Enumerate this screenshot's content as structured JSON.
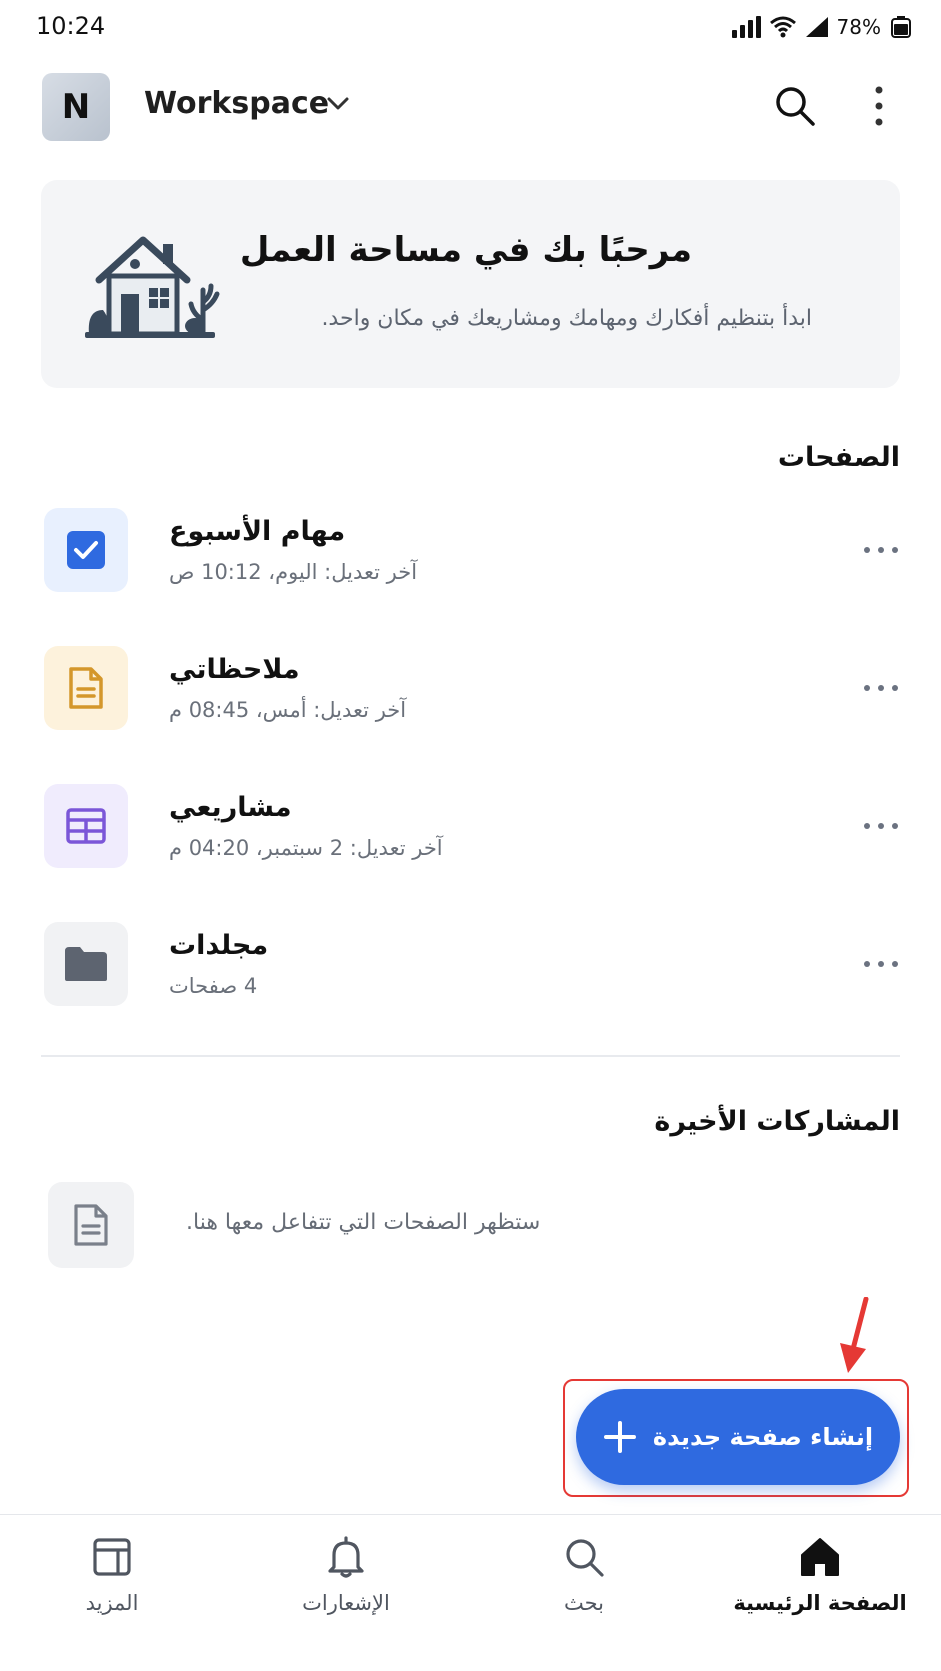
{
  "status_bar": {
    "time": "10:24",
    "battery": "78%"
  },
  "header": {
    "avatar_letter": "N",
    "workspace_name": "Workspace"
  },
  "welcome": {
    "title": "مرحبًا بك في مساحة العمل",
    "subtitle": "ابدأ بتنظيم أفكارك ومهامك ومشاريعك في مكان واحد."
  },
  "pages_section": {
    "title": "الصفحات",
    "items": [
      {
        "title": "مهام الأسبوع",
        "meta": "آخر تعديل: اليوم، 10:12 ص",
        "icon": "checkbox-icon",
        "icon_bg": "#e8f0fe",
        "icon_color": "#2f6ae0"
      },
      {
        "title": "ملاحظاتي",
        "meta": "آخر تعديل: أمس، 08:45 م",
        "icon": "document-icon",
        "icon_bg": "#fdf2dc",
        "icon_color": "#d4972b"
      },
      {
        "title": "مشاريعي",
        "meta": "آخر تعديل: 2 سبتمبر، 04:20 م",
        "icon": "table-icon",
        "icon_bg": "#f0ecfd",
        "icon_color": "#7b56d8"
      },
      {
        "title": "مجلدات",
        "meta": "4 صفحات",
        "icon": "folder-icon",
        "icon_bg": "#f1f2f4",
        "icon_color": "#5d6470"
      }
    ]
  },
  "recent_section": {
    "title": "المشاركات الأخيرة",
    "empty_text": "ستظهر الصفحات التي تتفاعل معها هنا."
  },
  "fab": {
    "label": "إنشاء صفحة جديدة",
    "color": "#2f6ae0"
  },
  "bottom_nav": {
    "items": [
      {
        "label": "الصفحة الرئيسية",
        "icon": "home-icon",
        "active": true
      },
      {
        "label": "بحث",
        "icon": "search-icon",
        "active": false
      },
      {
        "label": "الإشعارات",
        "icon": "bell-icon",
        "active": false
      },
      {
        "label": "المزيد",
        "icon": "more-panel-icon",
        "active": false
      }
    ]
  },
  "colors": {
    "accent": "#2f6ae0",
    "highlight": "#e53935"
  }
}
